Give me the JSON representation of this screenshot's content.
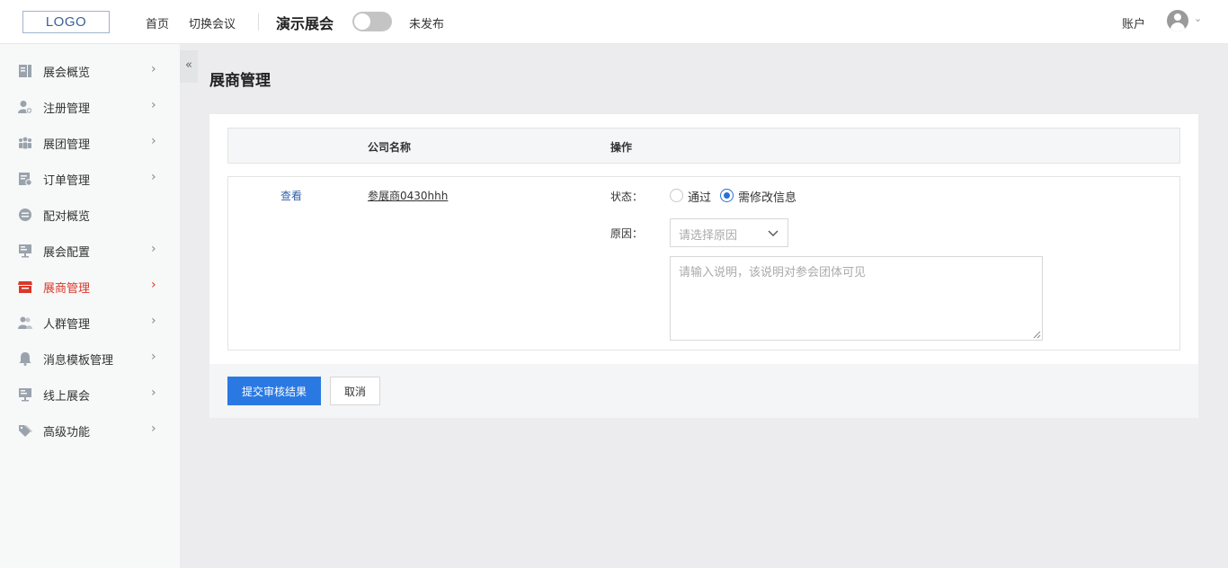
{
  "header": {
    "logo": "LOGO",
    "nav_home": "首页",
    "nav_switch": "切换会议",
    "expo_name": "演示展会",
    "publish_status": "未发布",
    "account": "账户"
  },
  "sidebar": {
    "collapse": "«",
    "items": [
      {
        "label": "展会概览",
        "icon": "book-icon",
        "chevron": "›"
      },
      {
        "label": "注册管理",
        "icon": "user-add-icon",
        "chevron": "›"
      },
      {
        "label": "展团管理",
        "icon": "group-icon",
        "chevron": "›"
      },
      {
        "label": "订单管理",
        "icon": "order-icon",
        "chevron": "›"
      },
      {
        "label": "配对概览",
        "icon": "match-icon",
        "chevron": ""
      },
      {
        "label": "展会配置",
        "icon": "config-icon",
        "chevron": "›"
      },
      {
        "label": "展商管理",
        "icon": "store-icon",
        "chevron": "›",
        "active": true
      },
      {
        "label": "人群管理",
        "icon": "people-icon",
        "chevron": "›"
      },
      {
        "label": "消息模板管理",
        "icon": "bell-icon",
        "chevron": "›"
      },
      {
        "label": "线上展会",
        "icon": "monitor-icon",
        "chevron": "›"
      },
      {
        "label": "高级功能",
        "icon": "tag-icon",
        "chevron": "›"
      }
    ]
  },
  "main": {
    "title": "展商管理",
    "table": {
      "col_company": "公司名称",
      "col_action": "操作",
      "row": {
        "view": "查看",
        "company": "参展商0430hhh",
        "status_label": "状态：",
        "option_pass": "通过",
        "option_revise": "需修改信息",
        "reason_label": "原因：",
        "reason_placeholder": "请选择原因",
        "note_placeholder": "请输入说明，该说明对参会团体可见"
      }
    },
    "submit": "提交审核结果",
    "cancel": "取消"
  },
  "colors": {
    "accent": "#2a79e2",
    "active_nav": "#d9382a"
  }
}
